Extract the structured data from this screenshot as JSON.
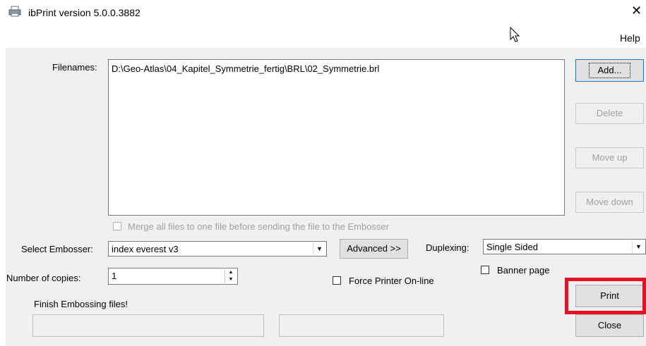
{
  "window": {
    "title": "ibPrint version 5.0.0.3882",
    "close_glyph": "✕",
    "menu_help": "Help"
  },
  "files": {
    "label": "Filenames:",
    "items": [
      "D:\\Geo-Atlas\\04_Kapitel_Symmetrie_fertig\\BRL\\02_Symmetrie.brl"
    ]
  },
  "buttons": {
    "add": "Add...",
    "delete": "Delete",
    "move_up": "Move up",
    "move_down": "Move down",
    "advanced": "Advanced >>",
    "print": "Print",
    "close": "Close"
  },
  "merge": {
    "label": "Merge all files to one file before sending the file to the Embosser",
    "checked": false,
    "enabled": false
  },
  "embosser": {
    "label": "Select Embosser:",
    "value": "index everest v3"
  },
  "duplex": {
    "label": "Duplexing:",
    "value": "Single Sided"
  },
  "banner": {
    "label": "Banner page",
    "checked": false
  },
  "copies": {
    "label": "Number of copies:",
    "value": "1"
  },
  "force_online": {
    "label": "Force Printer On-line",
    "checked": false
  },
  "status": {
    "text": "Finish Embossing files!"
  },
  "colors": {
    "highlight": "#e81123",
    "dialog_bg": "#f0f0f0"
  },
  "icons": {
    "app": "printer-icon",
    "cursor": "mouse-pointer-icon"
  }
}
